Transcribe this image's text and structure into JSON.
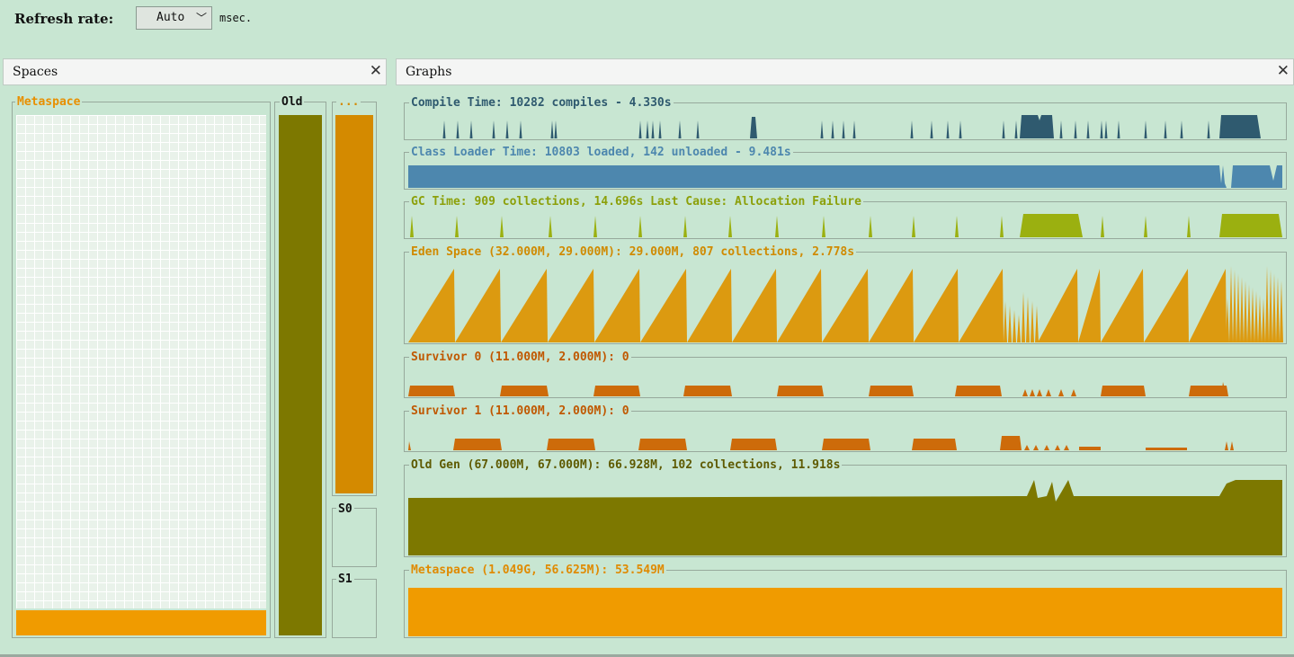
{
  "toolbar": {
    "refresh_label": "Refresh rate:",
    "refresh_value": "Auto",
    "chevron": "﹀",
    "unit": "msec."
  },
  "spaces_panel": {
    "title": "Spaces",
    "close": "✕",
    "metaspace_label": "Metaspace",
    "old_label": "Old",
    "eden_label": "...",
    "s0_label": "S0",
    "s1_label": "S1"
  },
  "graphs_panel": {
    "title": "Graphs",
    "close": "✕",
    "graphs": [
      {
        "label": "Compile Time: 10282 compiles - 4.330s",
        "color": "#2f5a6f",
        "text_color": "#2f5a6f"
      },
      {
        "label": "Class Loader Time: 10803 loaded, 142 unloaded - 9.481s",
        "color": "#4d87ae",
        "text_color": "#4d87ae"
      },
      {
        "label": "GC Time: 909 collections, 14.696s  Last Cause: Allocation Failure",
        "color": "#9bb010",
        "text_color": "#8ca00a"
      },
      {
        "label": "Eden Space (32.000M, 29.000M): 29.000M, 807 collections, 2.778s",
        "color": "#dc9a10",
        "text_color": "#d08a00"
      },
      {
        "label": "Survivor 0 (11.000M, 2.000M): 0",
        "color": "#cd6b0a",
        "text_color": "#c05800"
      },
      {
        "label": "Survivor 1 (11.000M, 2.000M): 0",
        "color": "#cd6b0a",
        "text_color": "#c05800"
      },
      {
        "label": "Old Gen (67.000M, 67.000M): 66.928M, 102 collections, 11.918s",
        "color": "#7d7800",
        "text_color": "#5e5a00"
      },
      {
        "label": "Metaspace (1.049G, 56.625M): 53.549M",
        "color": "#f09b00",
        "text_color": "#e08a00"
      }
    ]
  },
  "colors": {
    "background": "#c8e6d2",
    "old_fill": "#7d7800",
    "eden_fill": "#d48a00",
    "metaspace_fill": "#f09b00"
  },
  "space_fill_levels": {
    "metaspace": 0.05,
    "old": 1.0,
    "eden": 1.0,
    "s0": 0.0,
    "s1": 0.0
  }
}
